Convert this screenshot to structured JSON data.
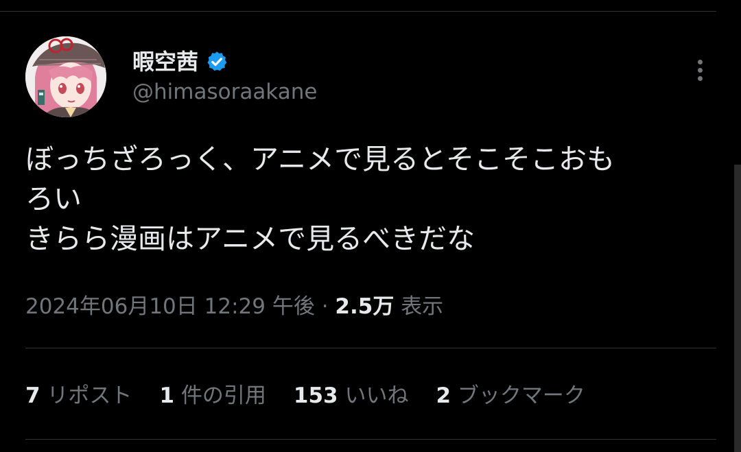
{
  "colors": {
    "background": "#000000",
    "primary_text": "#e7e9ea",
    "secondary_text": "#71767b",
    "divider": "#2f3336",
    "verified": "#1d9bf0"
  },
  "user": {
    "display_name": "暇空茜",
    "handle": "@himasoraakane",
    "verified": true,
    "avatar_icon": "avatar-anime-girl"
  },
  "tweet": {
    "lines": [
      "ぼっちざろっく、アニメで見るとそこそこおも",
      "ろい",
      "きらら漫画はアニメで見るべきだな"
    ]
  },
  "meta": {
    "timestamp": "2024年06月10日 12:29 午後",
    "separator": " · ",
    "views_count": "2.5万",
    "views_label": "表示"
  },
  "stats": [
    {
      "count": "7",
      "label": "リポスト"
    },
    {
      "count": "1",
      "label": "件の引用"
    },
    {
      "count": "153",
      "label": "いいね"
    },
    {
      "count": "2",
      "label": "ブックマーク"
    }
  ]
}
